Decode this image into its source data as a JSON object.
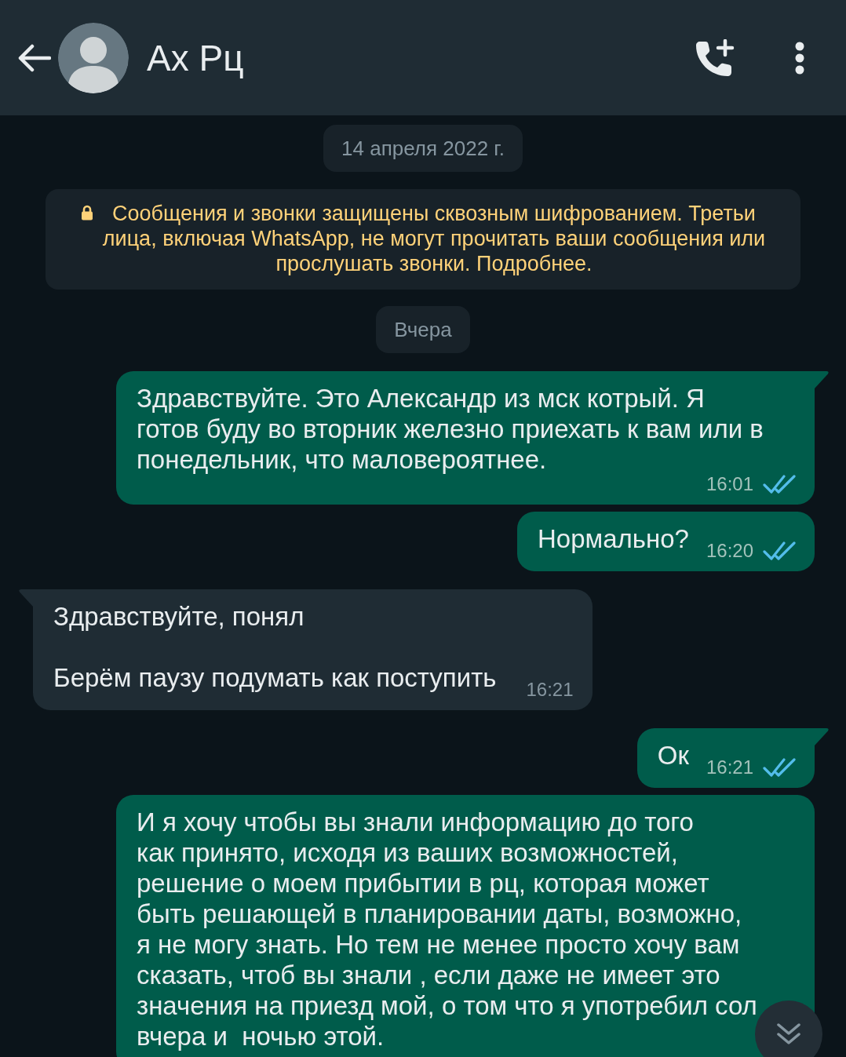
{
  "header": {
    "title": "Ах Рц"
  },
  "chat": [
    {
      "kind": "date",
      "text": "14 апреля 2022 г."
    },
    {
      "kind": "notice",
      "text": "Сообщения и звонки защищены сквозным шифрованием. Третьи\nлица, включая WhatsApp, не могут прочитать ваши сообщения или\nпрослушать звонки. Подробнее."
    },
    {
      "kind": "date",
      "text": "Вчера"
    },
    {
      "kind": "outgoing",
      "text": "Здравствуйте. Это Александр из мск котрый. Я\nготов буду во вторник железно приехать к вам или в\nпонедельник, что маловероятнее.",
      "time": "16:01",
      "tail": true,
      "read": true
    },
    {
      "kind": "outgoing",
      "text": "Нормально?",
      "time": "16:20",
      "tail": false,
      "read": true
    },
    {
      "kind": "incoming",
      "text": "Здравствуйте, понял\n\nБерём паузу подумать как поступить",
      "time": "16:21",
      "tail": true
    },
    {
      "kind": "outgoing",
      "text": "Ок",
      "time": "16:21",
      "tail": true,
      "read": true
    },
    {
      "kind": "outgoing",
      "text": "И я хочу чтобы вы знали информацию до того\nкак принято, исходя из ваших возможностей,\nрешение о моем прибытии в рц, которая может\nбыть решающей в планировании даты, возможно,\nя не могу знать. Но тем не менее просто хочу вам\nсказать, чтоб вы знали , если даже не имеет это\nзначения на приезд мой, о том что я употребил сол\nвчера и  ночью этой.",
      "tail": false
    }
  ]
}
